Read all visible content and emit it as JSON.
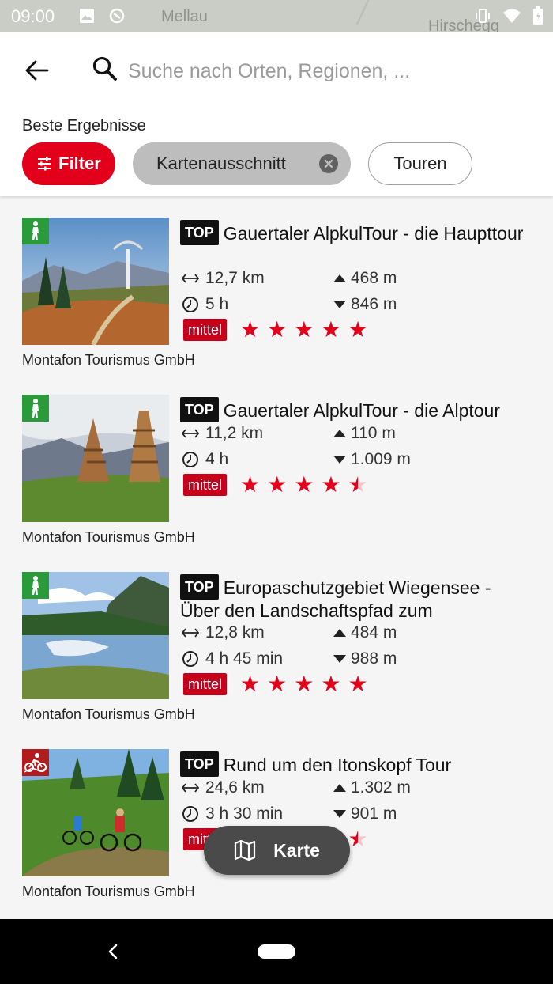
{
  "status_bar": {
    "time": "09:00",
    "map_labels": [
      "Mellau",
      "Hirschegg"
    ]
  },
  "search": {
    "placeholder": "Suche nach Orten, Regionen, ..."
  },
  "results_label": "Beste Ergebnisse",
  "chips": {
    "filter": "Filter",
    "map_section": "Kartenausschnitt",
    "tours": "Touren"
  },
  "colors": {
    "accent": "#e3001b",
    "difficulty": "#c8001a",
    "hike_badge": "#2a9a3a",
    "bike_badge": "#b31c1c"
  },
  "tours": [
    {
      "badge": "TOP",
      "title": "Gauertaler AlpkulTour - die Haupttour",
      "category_icon": "hiking-icon",
      "distance": "12,7 km",
      "duration": "5 h",
      "ascent": "468 m",
      "descent": "846 m",
      "difficulty": "mittel",
      "rating": 5,
      "author": "Montafon Tourismus GmbH"
    },
    {
      "badge": "TOP",
      "title": "Gauertaler AlpkulTour - die Alptour",
      "category_icon": "hiking-icon",
      "distance": "11,2 km",
      "duration": "4 h",
      "ascent": "110 m",
      "descent": "1.009 m",
      "difficulty": "mittel",
      "rating": 4.5,
      "author": "Montafon Tourismus GmbH"
    },
    {
      "badge": "TOP",
      "title": "Europaschutzgebiet Wiegensee - Über den Landschaftspfad zum",
      "category_icon": "hiking-icon",
      "distance": "12,8 km",
      "duration": "4 h 45 min",
      "ascent": "484 m",
      "descent": "988 m",
      "difficulty": "mittel",
      "rating": 5,
      "author": "Montafon Tourismus GmbH"
    },
    {
      "badge": "TOP",
      "title": "Rund um den Itonskopf Tour",
      "category_icon": "mountain-bike-icon",
      "distance": "24,6 km",
      "duration": "3 h 30 min",
      "ascent": "1.302 m",
      "descent": "901 m",
      "difficulty": "mittel",
      "rating": 4.5,
      "author": "Montafon Tourismus GmbH"
    }
  ],
  "fab": {
    "label": "Karte"
  }
}
